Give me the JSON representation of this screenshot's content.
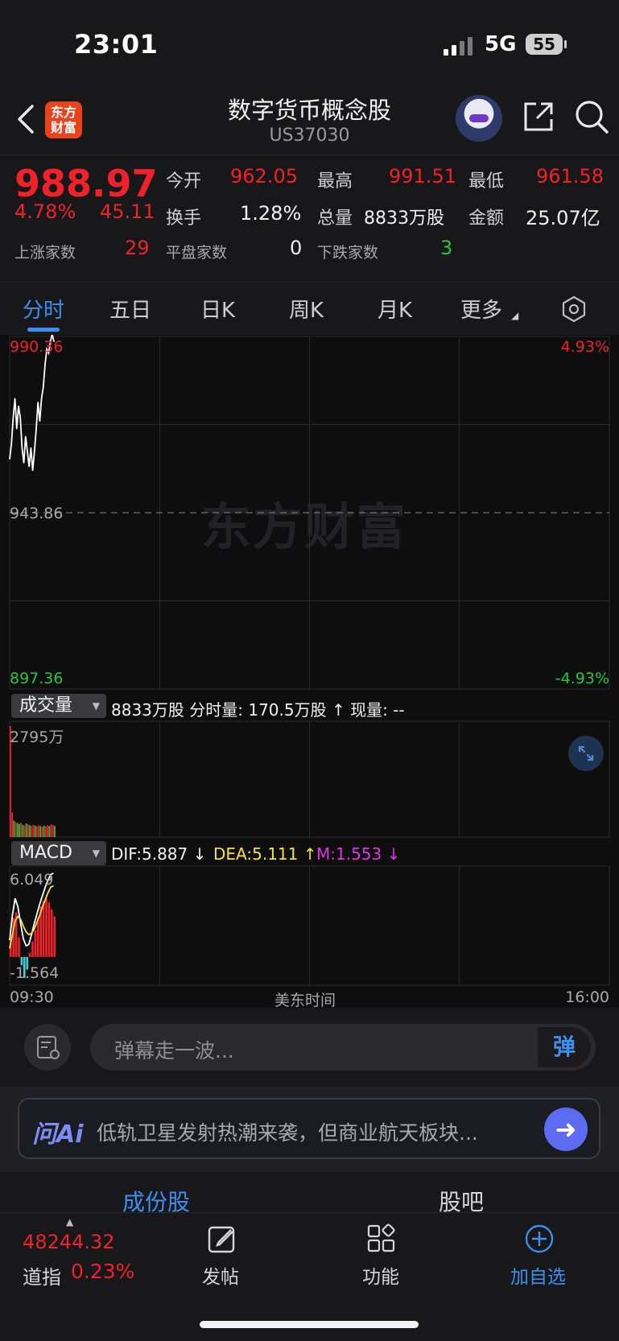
{
  "status_bar": {
    "time": "23:01",
    "network": "5G",
    "battery": "55"
  },
  "header": {
    "logo_text_1": "东方",
    "logo_text_2": "财富",
    "title": "数字货币概念股",
    "code": "US37030"
  },
  "quote": {
    "price": "988.97",
    "change_pct": "4.78%",
    "change": "45.11",
    "open_label": "今开",
    "open": "962.05",
    "high_label": "最高",
    "high": "991.51",
    "low_label": "最低",
    "low": "961.58",
    "turnover_label": "换手",
    "turnover": "1.28%",
    "volume_label": "总量",
    "volume": "8833万股",
    "amount_label": "金额",
    "amount": "25.07亿",
    "up_label": "上涨家数",
    "up_count": "29",
    "flat_label": "平盘家数",
    "flat_count": "0",
    "down_label": "下跌家数",
    "down_count": "3"
  },
  "tabs": [
    "分时",
    "五日",
    "日K",
    "周K",
    "月K",
    "更多"
  ],
  "chart_data": [
    {
      "type": "line",
      "title": "",
      "ylim": [
        897.36,
        990.36
      ],
      "y_top_label": "990.36",
      "y_mid_label": "943.86",
      "y_bottom_label": "897.36",
      "pct_top_label": "4.93%",
      "pct_bottom_label": "-4.93%",
      "x_start": "09:30",
      "x_end": "16:00",
      "x_label": "美东时间",
      "series": [
        {
          "values": [
            958,
            962,
            969,
            974,
            966,
            972,
            969,
            961,
            957,
            964,
            960,
            956,
            961,
            955,
            960,
            966,
            973,
            968,
            974,
            977,
            983,
            987,
            986,
            989,
            991,
            989
          ]
        }
      ]
    },
    {
      "type": "bar",
      "title": "成交量",
      "y_top_label": "2795万",
      "values": [
        2795,
        620,
        410,
        380,
        350,
        330,
        360,
        310,
        290,
        340,
        320,
        300,
        280,
        310,
        290,
        270,
        300,
        280,
        260,
        290,
        270,
        300,
        280,
        320,
        300,
        280
      ],
      "colors": [
        "up",
        "up",
        "down",
        "up",
        "down",
        "down",
        "up",
        "down",
        "up",
        "down",
        "up",
        "down",
        "up",
        "up",
        "down",
        "up",
        "up",
        "down",
        "up",
        "down",
        "up",
        "up",
        "down",
        "up",
        "up",
        "down"
      ]
    },
    {
      "type": "line",
      "title": "MACD",
      "ylim": [
        -1.564,
        6.049
      ],
      "y_top_label": "6.049",
      "y_bottom_label": "-1.564",
      "dif": [
        1.2,
        3.0,
        4.2,
        3.6,
        2.4,
        1.3,
        0.8,
        0.9,
        1.6,
        2.4,
        3.1,
        3.8,
        4.4,
        5.0,
        5.5,
        5.9,
        6.0
      ],
      "dea": [
        0.6,
        1.6,
        2.6,
        2.9,
        2.7,
        2.2,
        1.8,
        1.6,
        1.7,
        2.0,
        2.5,
        3.0,
        3.6,
        4.1,
        4.6,
        5.0,
        5.1
      ],
      "hist": [
        1.2,
        2.8,
        3.2,
        1.4,
        -0.6,
        -1.5,
        -0.9,
        0.3,
        1.1,
        1.9,
        2.8,
        3.6,
        4.0,
        4.2,
        3.9,
        3.4,
        2.9
      ]
    }
  ],
  "volume_header": {
    "dropdown": "成交量",
    "info": "8833万股 分时量: 170.5万股 ↑ 现量: --"
  },
  "macd_header": {
    "dropdown": "MACD",
    "dif": "DIF:5.887 ↓",
    "dea": "DEA:5.111 ↑",
    "m": "M:1.553 ↓"
  },
  "watermark": "东方财富",
  "comment": {
    "placeholder": "弹幕走一波...",
    "danmu_btn": "弹"
  },
  "ai": {
    "logo": "问Ai",
    "text": "低轨卫星发射热潮来袭，但商业航天板块..."
  },
  "constituents": {
    "tab1": "成份股",
    "tab2": "股吧"
  },
  "bottom_nav": {
    "index_value": "48244.32",
    "index_name": "道指",
    "index_change": "0.23%",
    "post": "发帖",
    "function": "功能",
    "add_watch": "加自选"
  },
  "colors": {
    "up": "#f0212a",
    "down": "#21c93a",
    "accent": "#3b8ff0",
    "dif": "#ffffff",
    "dea": "#f5e33b",
    "m": "#e033e0"
  }
}
